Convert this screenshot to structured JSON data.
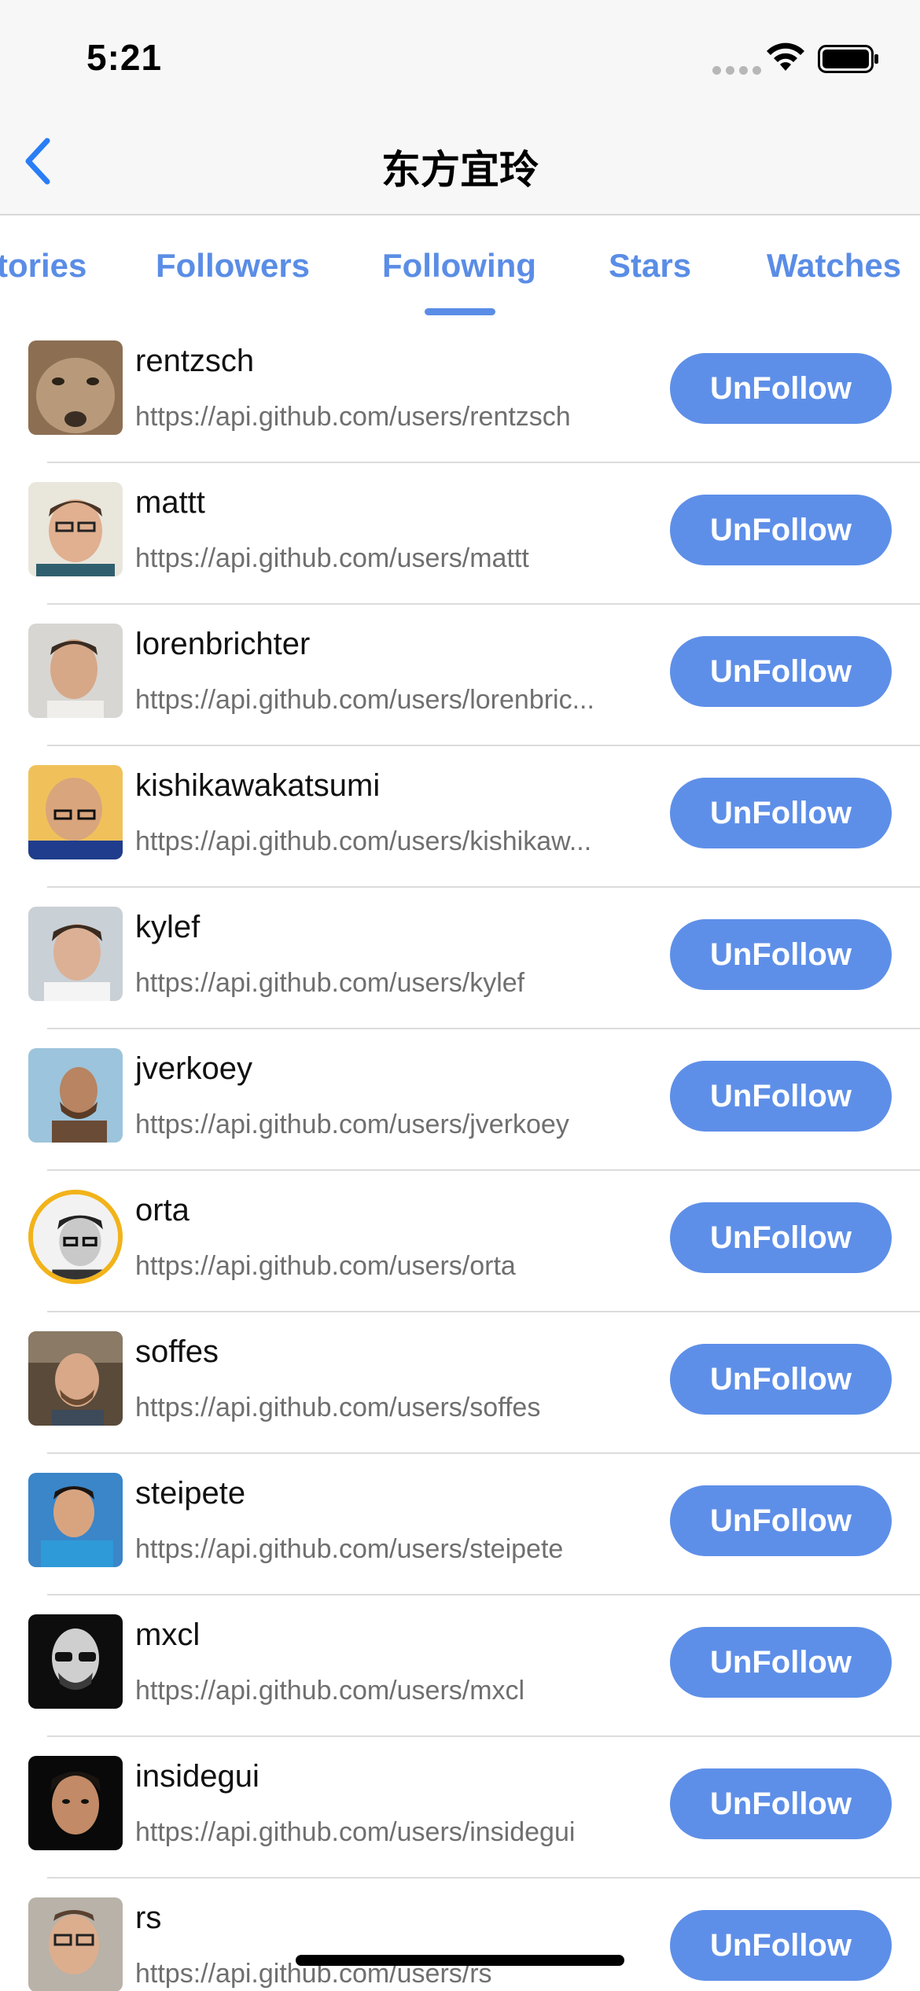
{
  "status_bar": {
    "time": "5:21"
  },
  "nav": {
    "title": "东方宜玲"
  },
  "tabs": [
    {
      "label": "tories"
    },
    {
      "label": "Followers"
    },
    {
      "label": "Following"
    },
    {
      "label": "Stars"
    },
    {
      "label": "Watches"
    }
  ],
  "users": [
    {
      "name": "rentzsch",
      "url": "https://api.github.com/users/rentzsch",
      "button": "UnFollow"
    },
    {
      "name": "mattt",
      "url": "https://api.github.com/users/mattt",
      "button": "UnFollow"
    },
    {
      "name": "lorenbrichter",
      "url": "https://api.github.com/users/lorenbric...",
      "button": "UnFollow"
    },
    {
      "name": "kishikawakatsumi",
      "url": "https://api.github.com/users/kishikaw...",
      "button": "UnFollow"
    },
    {
      "name": "kylef",
      "url": "https://api.github.com/users/kylef",
      "button": "UnFollow"
    },
    {
      "name": "jverkoey",
      "url": "https://api.github.com/users/jverkoey",
      "button": "UnFollow"
    },
    {
      "name": "orta",
      "url": "https://api.github.com/users/orta",
      "button": "UnFollow"
    },
    {
      "name": "soffes",
      "url": "https://api.github.com/users/soffes",
      "button": "UnFollow"
    },
    {
      "name": "steipete",
      "url": "https://api.github.com/users/steipete",
      "button": "UnFollow"
    },
    {
      "name": "mxcl",
      "url": "https://api.github.com/users/mxcl",
      "button": "UnFollow"
    },
    {
      "name": "insidegui",
      "url": "https://api.github.com/users/insidegui",
      "button": "UnFollow"
    },
    {
      "name": "rs",
      "url": "https://api.github.com/users/rs",
      "button": "UnFollow"
    }
  ],
  "colors": {
    "accent": "#5a8de6",
    "button_bg": "#5e8fe8",
    "back_arrow": "#2a7df6"
  },
  "icons": [
    "back-chevron-icon",
    "signal-icon",
    "wifi-icon",
    "battery-icon"
  ]
}
